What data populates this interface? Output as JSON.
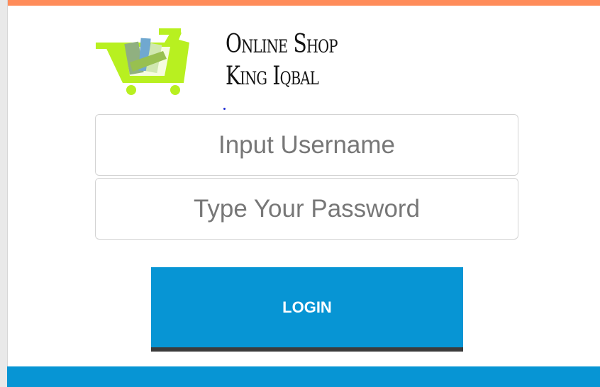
{
  "brand": {
    "line1": "Online Shop",
    "line2": "King Iqbal",
    "logo_icon": "shopping-cart-icon"
  },
  "form": {
    "username_placeholder": "Input Username",
    "password_placeholder": "Type Your Password",
    "login_label": "LOGIN"
  },
  "colors": {
    "top_border": "#ff8c5a",
    "accent": "#0795d4",
    "cart": "#b8f020",
    "button_shadow": "#3b3b3b"
  }
}
